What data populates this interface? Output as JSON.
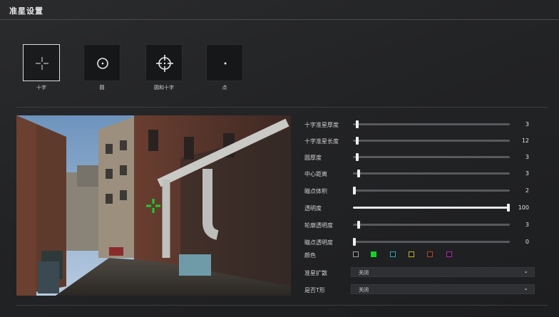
{
  "header": {
    "title": "准星设置"
  },
  "crosshair_styles": [
    {
      "label": "十字",
      "icon": "cross-icon",
      "selected": true
    },
    {
      "label": "圆",
      "icon": "circle-dot-icon",
      "selected": false
    },
    {
      "label": "圆和十字",
      "icon": "circle-cross-icon",
      "selected": false
    },
    {
      "label": "点",
      "icon": "dot-icon",
      "selected": false
    }
  ],
  "preview": {
    "crosshair_color": "#16d12a"
  },
  "settings": [
    {
      "label": "十字准星厚度",
      "value": "3",
      "fraction": 0.02
    },
    {
      "label": "十字准星长度",
      "value": "12",
      "fraction": 0.02
    },
    {
      "label": "圆厚度",
      "value": "3",
      "fraction": 0.02
    },
    {
      "label": "中心距离",
      "value": "3",
      "fraction": 0.03
    },
    {
      "label": "瞄点体积",
      "value": "2",
      "fraction": 0.0
    },
    {
      "label": "透明度",
      "value": "100",
      "fraction": 1.0
    },
    {
      "label": "轮廓透明度",
      "value": "3",
      "fraction": 0.03
    },
    {
      "label": "瞄点透明度",
      "value": "0",
      "fraction": 0.0
    }
  ],
  "color": {
    "label": "颜色",
    "swatches": [
      {
        "name": "white",
        "hex": "#a0a0a0",
        "selected": false
      },
      {
        "name": "green",
        "hex": "#16d12a",
        "selected": true
      },
      {
        "name": "cyan",
        "hex": "#2aa6b8",
        "selected": false
      },
      {
        "name": "yellow",
        "hex": "#c8b02a",
        "selected": false
      },
      {
        "name": "red",
        "hex": "#b8452a",
        "selected": false
      },
      {
        "name": "magenta",
        "hex": "#b02ab0",
        "selected": false
      }
    ]
  },
  "dropdowns": [
    {
      "label": "准星扩散",
      "value": "关闭"
    },
    {
      "label": "是否T形",
      "value": "关闭"
    }
  ]
}
